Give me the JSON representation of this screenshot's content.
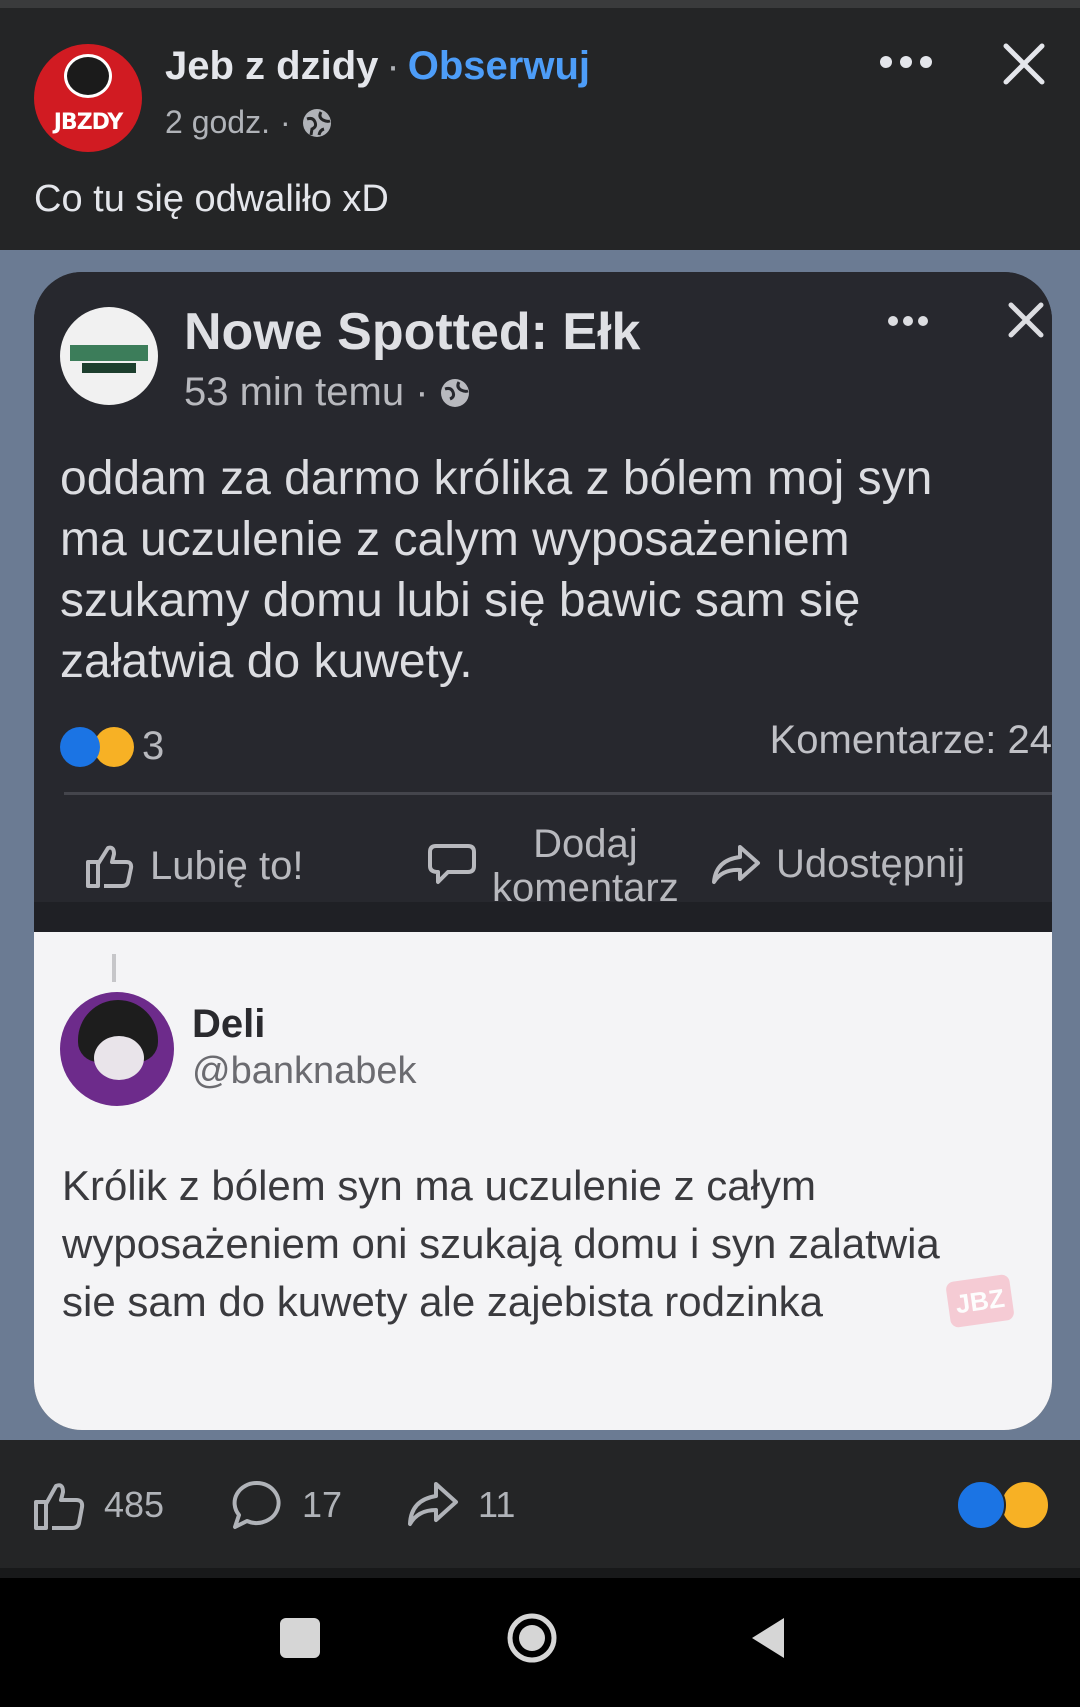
{
  "post": {
    "page_name": "Jeb z dzidy",
    "separator": "·",
    "follow_label": "Obserwuj",
    "time": "2 godz.",
    "meta_separator": "·",
    "caption": "Co tu się odwaliło xD",
    "avatar_text": "JBZDY"
  },
  "embedded_post": {
    "page_name": "Nowe Spotted: Ełk",
    "time": "53 min temu ·",
    "body": "oddam za darmo królika z bólem moj syn\nma uczulenie z calym wyposażeniem\nszukamy domu lubi się bawic sam się\nzałatwia do kuwety.",
    "reaction_count": "3",
    "comments": "Komentarze: 24",
    "actions": {
      "like": "Lubię to!",
      "comment": "Dodaj\nkomentarz",
      "share": "Udostępnij"
    }
  },
  "tweet": {
    "name": "Deli",
    "handle": "@banknabek",
    "body": "Królik z bólem syn ma uczulenie z całym\nwyposażeniem oni szukają domu i syn zalatwia\nsie sam do kuwety ale zajebista rodzinka",
    "watermark": "JBZ"
  },
  "footer": {
    "likes": "485",
    "comments": "17",
    "shares": "11"
  },
  "colors": {
    "background": "#242526",
    "follow_link": "#4d9df8",
    "like_reaction": "#1b74e4",
    "haha_reaction": "#f7b125",
    "brand_red": "#d11b22"
  },
  "icons": [
    "globe-icon",
    "more-icon",
    "close-icon",
    "like-icon",
    "comment-icon",
    "share-icon",
    "recent-apps-icon",
    "home-icon",
    "back-icon"
  ]
}
